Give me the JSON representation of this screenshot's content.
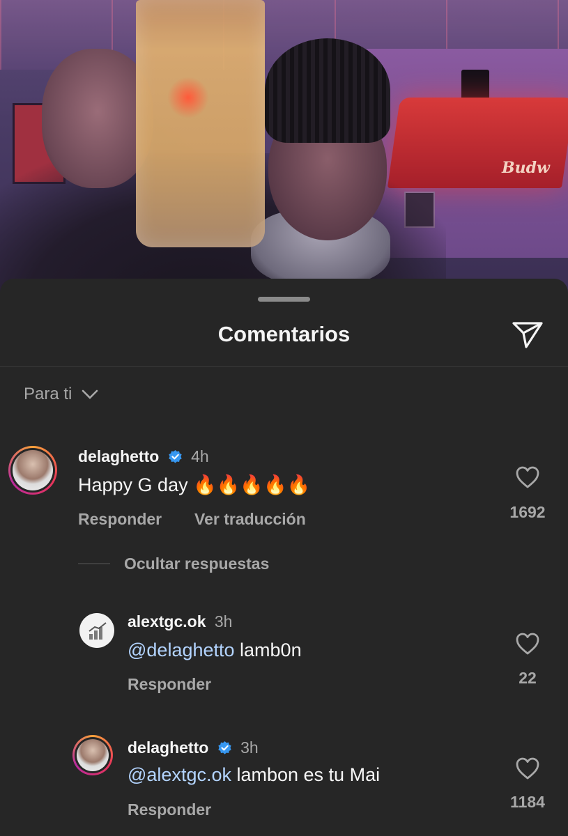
{
  "sheet": {
    "title": "Comentarios"
  },
  "filter": {
    "label": "Para ti"
  },
  "comments": [
    {
      "username": "delaghetto",
      "verified": true,
      "time": "4h",
      "text": "Happy G day 🔥🔥🔥🔥🔥",
      "reply_label": "Responder",
      "translate_label": "Ver traducción",
      "likes": "1692",
      "hide_replies_label": "Ocultar respuestas"
    }
  ],
  "replies": [
    {
      "username": "alextgc.ok",
      "verified": false,
      "time": "3h",
      "mention": "@delaghetto",
      "text": " lamb0n",
      "reply_label": "Responder",
      "likes": "22"
    },
    {
      "username": "delaghetto",
      "verified": true,
      "time": "3h",
      "mention": "@alextgc.ok",
      "text": " lambon es tu Mai",
      "reply_label": "Responder",
      "likes": "1184"
    }
  ],
  "photo": {
    "lamp_text": "Budw"
  },
  "colors": {
    "background": "#262626",
    "mention": "#b3d4ff",
    "verified": "#3797f0",
    "muted": "#a8a8a8"
  },
  "icons": [
    "send-icon",
    "chevron-down-icon",
    "verified-badge-icon",
    "heart-icon"
  ]
}
